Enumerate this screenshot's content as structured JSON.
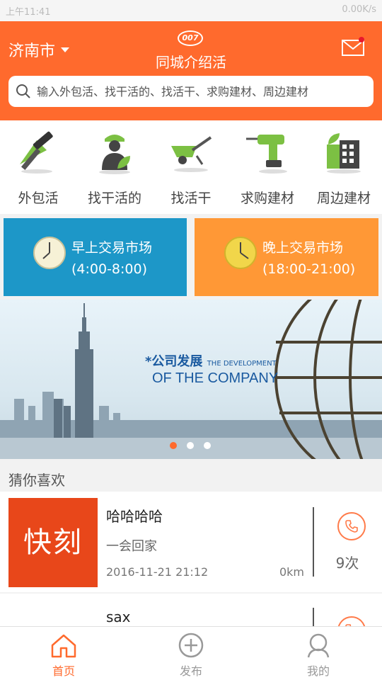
{
  "status_bar": {
    "time": "上午11:41",
    "right": "0.00K/s"
  },
  "header": {
    "city": "济南市",
    "logo_text": "007",
    "title": "同城介绍活",
    "search_placeholder": "输入外包活、找干活的、找活干、求购建材、周边建材"
  },
  "categories": [
    {
      "label": "外包活",
      "icon": "hammer-icon"
    },
    {
      "label": "找干活的",
      "icon": "worker-icon"
    },
    {
      "label": "找活干",
      "icon": "wheelbarrow-icon"
    },
    {
      "label": "求购建材",
      "icon": "drill-icon"
    },
    {
      "label": "周边建材",
      "icon": "building-icon"
    }
  ],
  "markets": [
    {
      "title": "早上交易市场",
      "hours": "(4:00-8:00)",
      "color": "#1d97c8"
    },
    {
      "title": "晚上交易市场",
      "hours": "(18:00-21:00)",
      "color": "#ff9836"
    }
  ],
  "banner": {
    "line1": "*公司发展",
    "line1_en": "THE DEVELOPMENT",
    "line2": "OF THE COMPANY",
    "page_count": 3,
    "active_page": 1
  },
  "section_title": "猜你喜欢",
  "listings": [
    {
      "thumb_text": "快刻",
      "name": "哈哈哈哈",
      "desc": "一会回家",
      "date": "2016-11-21 21:12",
      "distance": "0km",
      "count": "9次"
    },
    {
      "thumb_text": "",
      "name": "sax",
      "desc": "",
      "date": "",
      "distance": "",
      "count": ""
    }
  ],
  "tabs": [
    {
      "label": "首页",
      "icon": "home-icon",
      "active": true
    },
    {
      "label": "发布",
      "icon": "plus-circle-icon",
      "active": false
    },
    {
      "label": "我的",
      "icon": "user-icon",
      "active": false
    }
  ],
  "colors": {
    "accent": "#ff6a2d",
    "morning": "#1d97c8",
    "evening": "#ff9836"
  }
}
